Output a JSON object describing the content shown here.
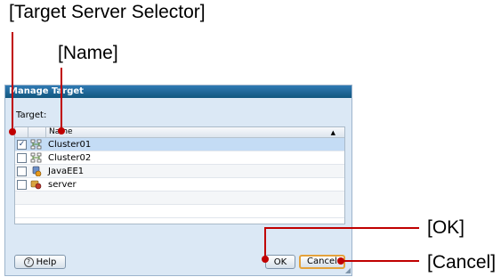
{
  "annotations": {
    "target_server_selector": "[Target Server Selector]",
    "name": "[Name]",
    "ok": "[OK]",
    "cancel": "[Cancel]"
  },
  "dialog": {
    "title": "Manage Target",
    "target_label": "Target:",
    "table": {
      "columns": [
        "",
        "",
        "Name"
      ],
      "sort_indicator": "▲",
      "rows": [
        {
          "checked": true,
          "icon": "cluster-icon",
          "name": "Cluster01",
          "selected": true
        },
        {
          "checked": false,
          "icon": "cluster-icon",
          "name": "Cluster02",
          "selected": false
        },
        {
          "checked": false,
          "icon": "javaee-instance-icon",
          "name": "JavaEE1",
          "selected": false
        },
        {
          "checked": false,
          "icon": "server-instance-icon",
          "name": "server",
          "selected": false
        }
      ]
    },
    "buttons": {
      "help": "Help",
      "help_glyph": "?",
      "ok": "OK",
      "cancel": "Cancel"
    }
  },
  "colors": {
    "callout": "#c00000",
    "titlebar": "#1f6aa0",
    "selected_row": "#c4dcf5",
    "dialog_bg": "#dbe8f5"
  }
}
